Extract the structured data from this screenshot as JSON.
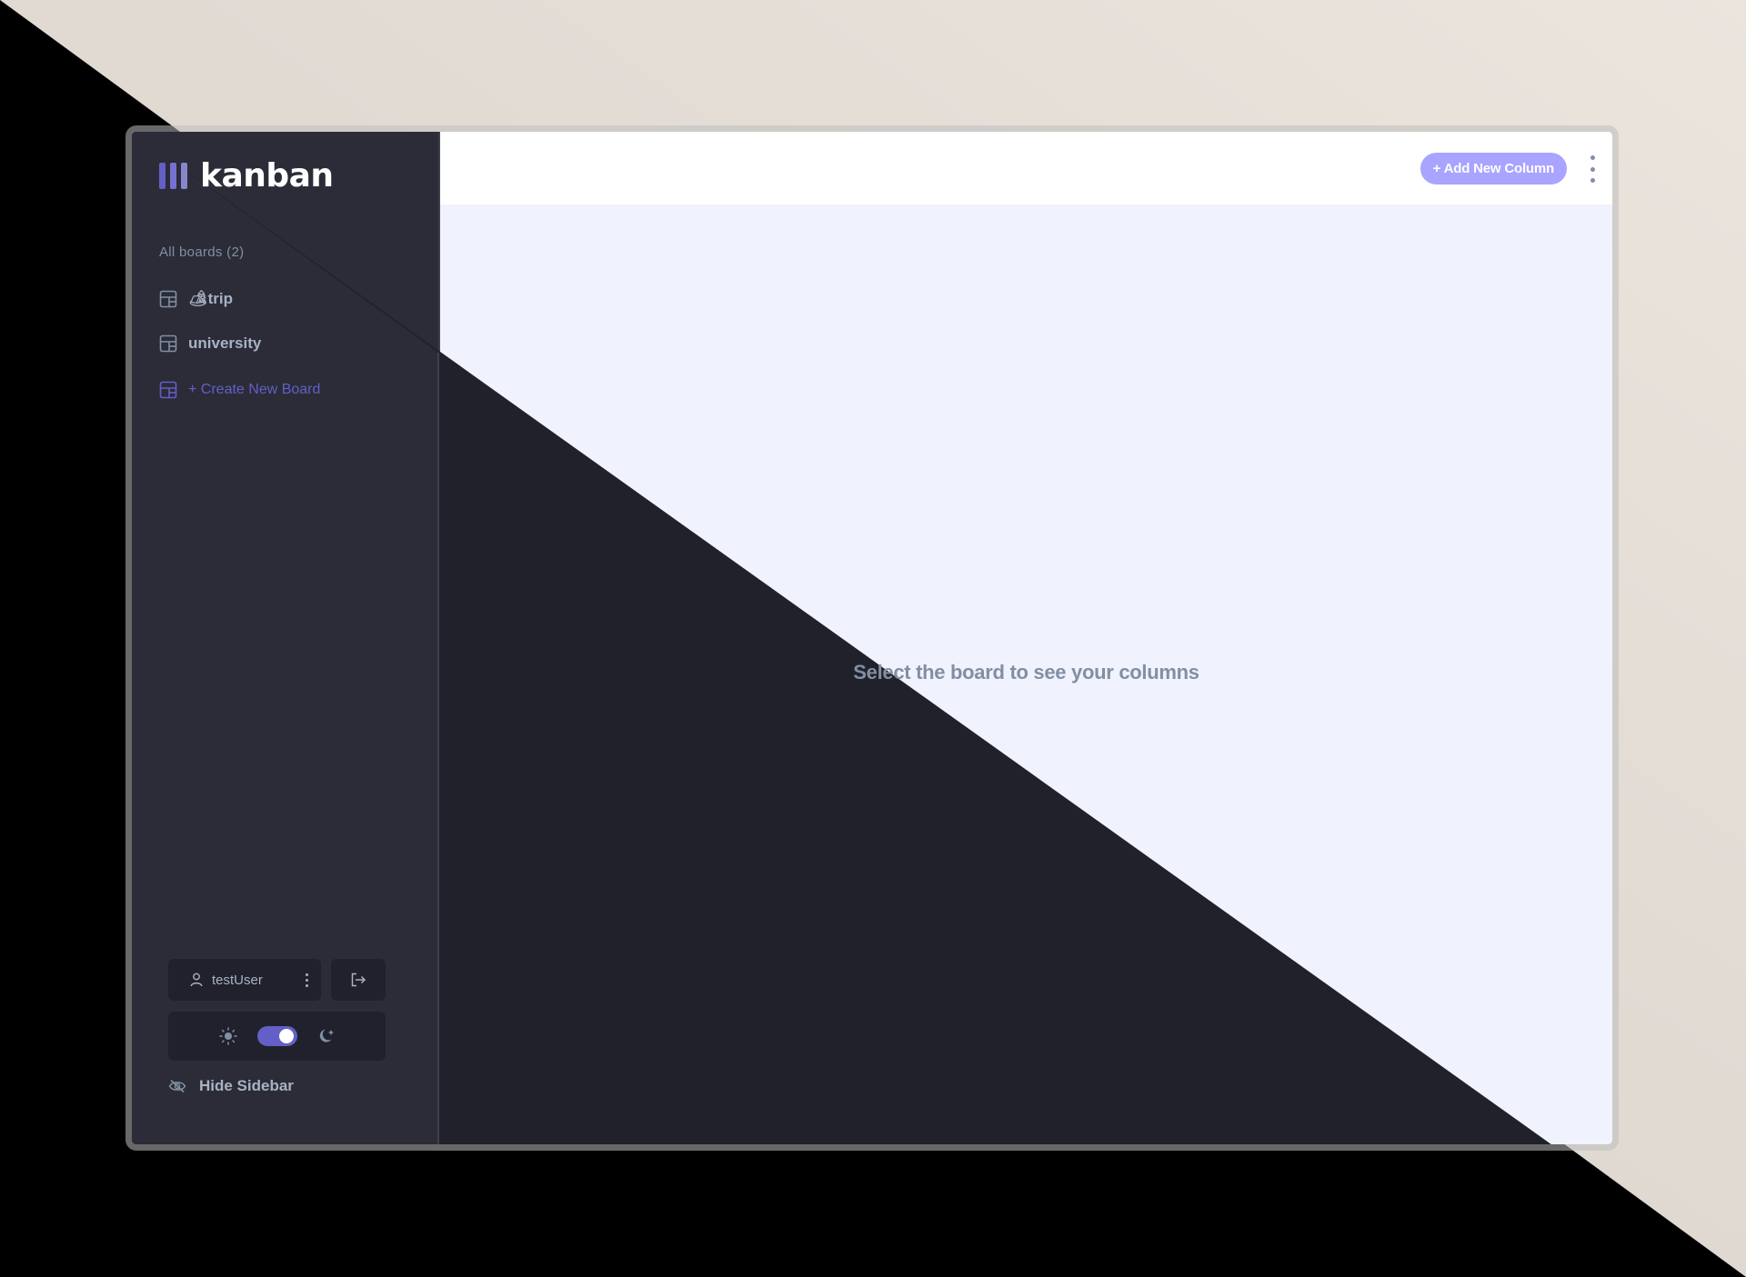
{
  "app": {
    "logo_text": "kanban",
    "colors": {
      "accent": "#635fc7",
      "accent_light": "#a8a4ff",
      "sidebar_bg": "#2b2c37",
      "dark_bg": "#20212c",
      "main_bg": "#f0f3fd",
      "muted_text": "#828fa3"
    }
  },
  "sidebar": {
    "boards_heading": "All boards (2)",
    "boards": [
      {
        "label": "🏕trip",
        "icon": "board-icon"
      },
      {
        "label": "university",
        "icon": "board-icon"
      }
    ],
    "create_board_label": "+ Create New Board",
    "user": {
      "name": "testUser",
      "user_icon": "user-icon",
      "more_icon": "vertical-dots-icon"
    },
    "logout_icon": "logout-icon",
    "theme": {
      "light_icon": "sun-icon",
      "dark_icon": "moon-icon",
      "dark_mode_on": true
    },
    "hide_sidebar_label": "Hide Sidebar",
    "hide_sidebar_icon": "eye-slash-icon"
  },
  "header": {
    "add_column_label": "+ Add New Column",
    "menu_icon": "vertical-dots-icon"
  },
  "main": {
    "empty_message": "Select the board to see your columns"
  }
}
